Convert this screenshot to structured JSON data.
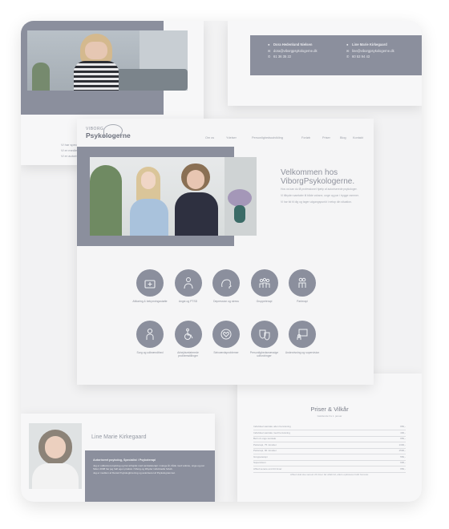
{
  "colors": {
    "accent": "#8b8f9d",
    "background": "#f2f2f3"
  },
  "top_left": {
    "photo_icon": "woman-covering-face-photo",
    "caption_lines": [
      "Vi har specialister i psykiatri.",
      "Vi er medlem af Dansk Psykologforening.",
      "Vi er autoriseret af Psykolognævnet."
    ]
  },
  "contacts": {
    "left": {
      "name": "Dora Hedenlund Nielsen",
      "email": "dora@viborgpsykologerne.dk",
      "phone": "61 36 35 22"
    },
    "right": {
      "name": "Line Marie Kirkegaard",
      "email": "line@viborgpsykologerne.dk",
      "phone": "60 53 94 43"
    }
  },
  "site": {
    "logo_small": "VIBORG",
    "logo_large": "Psykologerne",
    "nav": [
      "Om os",
      "Ydelser",
      "Personlighedsudvikling",
      "Forløb",
      "Priser",
      "Blog",
      "Kontakt"
    ],
    "welcome_line1": "Velkommen hos",
    "welcome_line2": "ViborgPsykologerne.",
    "intro": [
      "Hos os kan du få professionel hjælp af autoriserede psykologer.",
      "Vi tilbyder samtaler til både voksne, unge og par i trygge rammer.",
      "Vi har tid til dig og tager udgangspunkt i netop din situation."
    ],
    "services": [
      {
        "label": "Afklaring & bekymringsstøtte",
        "icon": "medical-case-icon"
      },
      {
        "label": "Angst og PTSD",
        "icon": "person-icon"
      },
      {
        "label": "Depression og stress",
        "icon": "head-brain-icon"
      },
      {
        "label": "Gruppeterapi",
        "icon": "group-icon"
      },
      {
        "label": "Parterapi",
        "icon": "couple-icon"
      },
      {
        "label": "Sorg og udbrændthed",
        "icon": "person-thinking-icon"
      },
      {
        "label": "Arbejdsrelaterede problemstillinger",
        "icon": "wheelchair-icon"
      },
      {
        "label": "Selvværdsproblemer",
        "icon": "heart-head-icon"
      },
      {
        "label": "Personlighedsmæssige udfordringer",
        "icon": "masks-icon"
      },
      {
        "label": "Undervisning og supervision",
        "icon": "board-icon"
      }
    ]
  },
  "prices": {
    "title": "Priser & Vilkår",
    "subtitle": "Gældende fra 1. januar",
    "rows": [
      {
        "label": "Individuel samtale uden henvisning",
        "value": "950,-"
      },
      {
        "label": "Individuel samtale med henvisning",
        "value": "400,-"
      },
      {
        "label": "Børn & unge samtale",
        "value": "950,-"
      },
      {
        "label": "Parterapi, 75 minutter",
        "value": "1300,-"
      },
      {
        "label": "Parterapi, 90 minutter",
        "value": "1500,-"
      },
      {
        "label": "Gruppeterapi",
        "value": "550,-"
      },
      {
        "label": "Supervision",
        "value": "900,-"
      },
      {
        "label": "Afbud senere end 24 timer",
        "value": "950,-"
      }
    ],
    "footer": "Afbud skal ske senest 24 timer før aftalt tid, ellers opkræves fuldt honorar."
  },
  "profile": {
    "name": "Line Marie Kirkegaard",
    "heading": "Autoriseret psykolog, Specialist i Psykoterapi",
    "paragraphs": [
      "Jeg er uddannet psykolog og har arbejdet med samtaleterapi i mange år, både med voksne, unge og par.",
      "Siden 2008 har jeg haft egen praksis i Viborg og tilbyder individuelle forløb.",
      "Jeg er medlem af Dansk Psykologforening og autoriseret af Psykolognævnet."
    ]
  }
}
